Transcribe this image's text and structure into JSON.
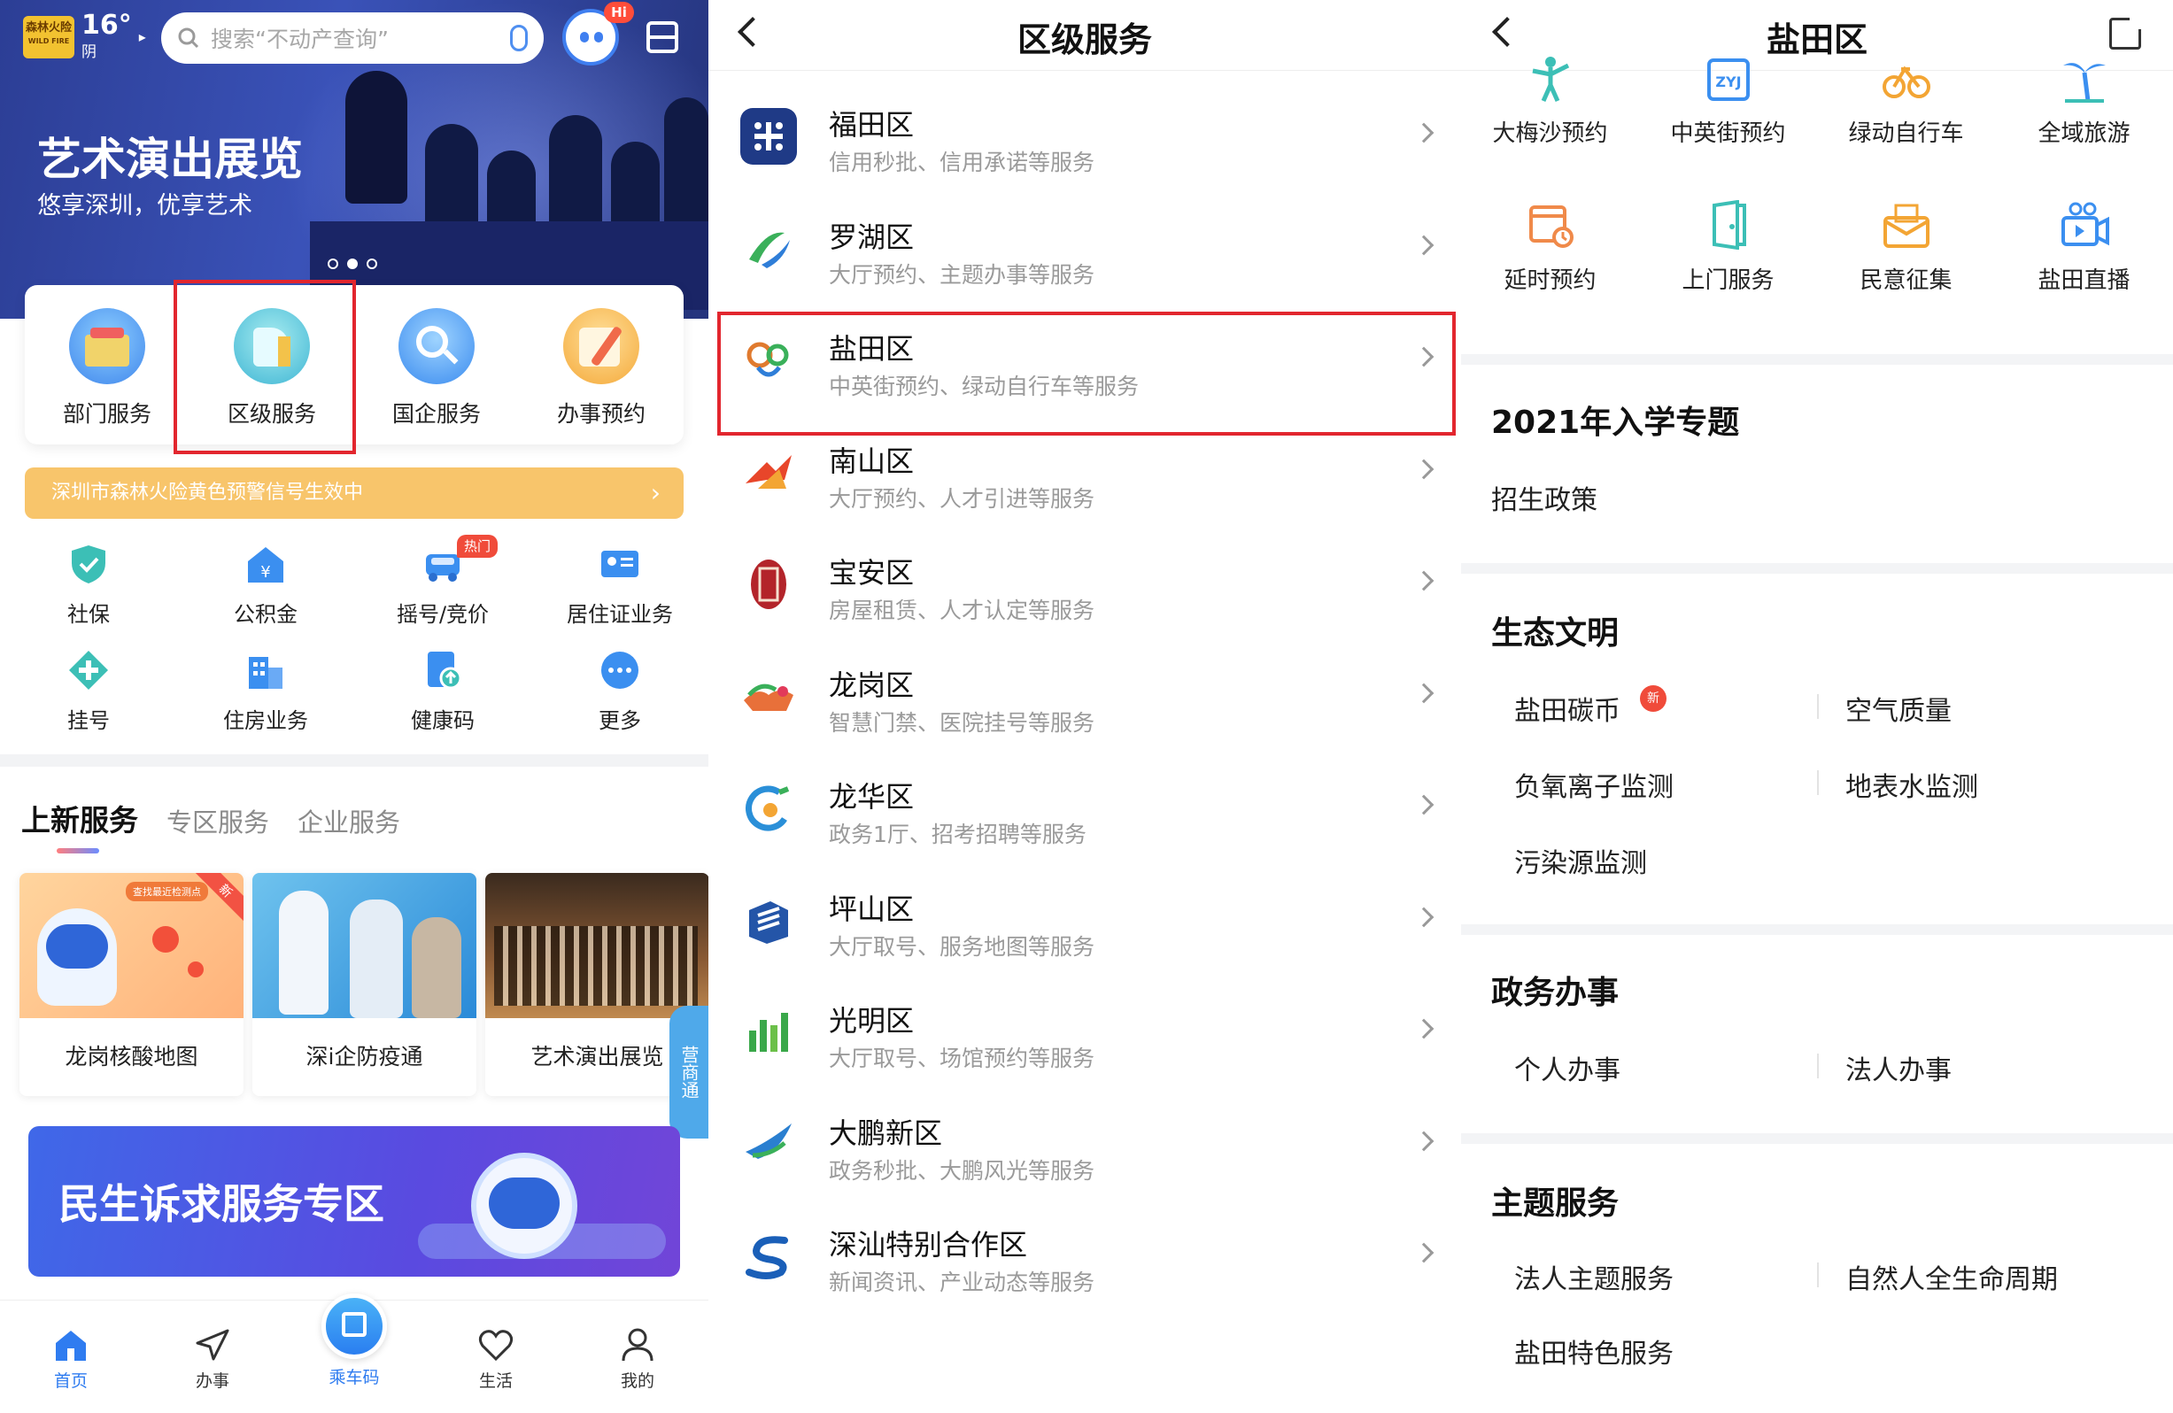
{
  "home": {
    "weather": {
      "badge_line1": "森林火险",
      "badge_line2": "WILD FIRE",
      "temp": "16°",
      "cond": "阴"
    },
    "search": {
      "placeholder": "搜索“不动产查询”"
    },
    "hi_badge": "Hi",
    "hero": {
      "title": "艺术演出展览",
      "subtitle": "悠享深圳，优享艺术"
    },
    "quick": [
      {
        "label": "部门服务",
        "icon": "department-service-icon",
        "color": "#4f9cf0"
      },
      {
        "label": "区级服务",
        "icon": "district-service-icon",
        "color": "#42b9d6"
      },
      {
        "label": "国企服务",
        "icon": "soe-service-icon",
        "color": "#3d8ef0"
      },
      {
        "label": "办事预约",
        "icon": "appointment-icon",
        "color": "#f3a534"
      }
    ],
    "alert": "深圳市森林火险黄色预警信号生效中",
    "services_row1": [
      {
        "label": "社保",
        "icon": "shield-check-icon"
      },
      {
        "label": "公积金",
        "icon": "fund-house-icon"
      },
      {
        "label": "摇号/竞价",
        "icon": "car-icon"
      },
      {
        "label": "居住证业务",
        "icon": "id-card-icon"
      }
    ],
    "services_row2": [
      {
        "label": "挂号",
        "icon": "medical-plus-icon"
      },
      {
        "label": "住房业务",
        "icon": "building-icon"
      },
      {
        "label": "健康码",
        "icon": "health-code-icon"
      },
      {
        "label": "更多",
        "icon": "more-dots-icon"
      }
    ],
    "hot_badge": "热门",
    "tabs": {
      "active": "上新服务",
      "other1": "专区服务",
      "other2": "企业服务"
    },
    "cards": [
      {
        "label": "龙岗核酸地图",
        "corner": "新",
        "tag": "查找最近检测点"
      },
      {
        "label": "深i企防疫通"
      },
      {
        "label": "艺术演出展览"
      }
    ],
    "side_tab": "营商通",
    "banner": "民生诉求服务专区",
    "nav": [
      {
        "label": "首页",
        "icon": "home-icon"
      },
      {
        "label": "办事",
        "icon": "send-icon"
      },
      {
        "label": "乘车码",
        "icon": "bus-code-icon"
      },
      {
        "label": "生活",
        "icon": "heart-icon"
      },
      {
        "label": "我的",
        "icon": "user-icon"
      }
    ]
  },
  "district": {
    "title": "区级服务",
    "items": [
      {
        "name": "福田区",
        "desc": "信用秒批、信用承诺等服务",
        "color": "#1f3a86"
      },
      {
        "name": "罗湖区",
        "desc": "大厅预约、主题办事等服务",
        "color": "#3ab05a"
      },
      {
        "name": "盐田区",
        "desc": "中英街预约、绿动自行车等服务",
        "color": "#e07a2e"
      },
      {
        "name": "南山区",
        "desc": "大厅预约、人才引进等服务",
        "color": "#e8462a"
      },
      {
        "name": "宝安区",
        "desc": "房屋租赁、人才认定等服务",
        "color": "#b3242a"
      },
      {
        "name": "龙岗区",
        "desc": "智慧门禁、医院挂号等服务",
        "color": "#e8703a"
      },
      {
        "name": "龙华区",
        "desc": "政务1厅、招考招聘等服务",
        "color": "#2a8fd8"
      },
      {
        "name": "坪山区",
        "desc": "大厅取号、服务地图等服务",
        "color": "#2455a8"
      },
      {
        "name": "光明区",
        "desc": "大厅取号、场馆预约等服务",
        "color": "#3aa84a"
      },
      {
        "name": "大鹏新区",
        "desc": "政务秒批、大鹏风光等服务",
        "color": "#2a7fd0"
      },
      {
        "name": "深汕特别合作区",
        "desc": "新闻资讯、产业动态等服务",
        "color": "#1a5fb8"
      }
    ]
  },
  "yantian": {
    "title": "盐田区",
    "grid_row1": [
      {
        "label": "大梅沙预约",
        "icon": "dancer-icon"
      },
      {
        "label": "中英街预约",
        "icon": "zyj-calendar-icon",
        "code": "ZYJ"
      },
      {
        "label": "绿动自行车",
        "icon": "bicycle-icon"
      },
      {
        "label": "全域旅游",
        "icon": "palm-tree-icon"
      }
    ],
    "grid_row2": [
      {
        "label": "延时预约",
        "icon": "calendar-clock-icon"
      },
      {
        "label": "上门服务",
        "icon": "door-icon"
      },
      {
        "label": "民意征集",
        "icon": "mailbox-icon"
      },
      {
        "label": "盐田直播",
        "icon": "video-camera-icon"
      }
    ],
    "sections": [
      {
        "title": "2021年入学专题",
        "items": [
          "招生政策"
        ]
      },
      {
        "title": "生态文明",
        "items": [
          "盐田碳币",
          "空气质量",
          "负氧离子监测",
          "地表水监测",
          "污染源监测"
        ],
        "new_badge": "新"
      },
      {
        "title": "政务办事",
        "items": [
          "个人办事",
          "法人办事"
        ]
      },
      {
        "title": "主题服务",
        "items": [
          "法人主题服务",
          "自然人全生命周期",
          "盐田特色服务"
        ]
      }
    ]
  }
}
